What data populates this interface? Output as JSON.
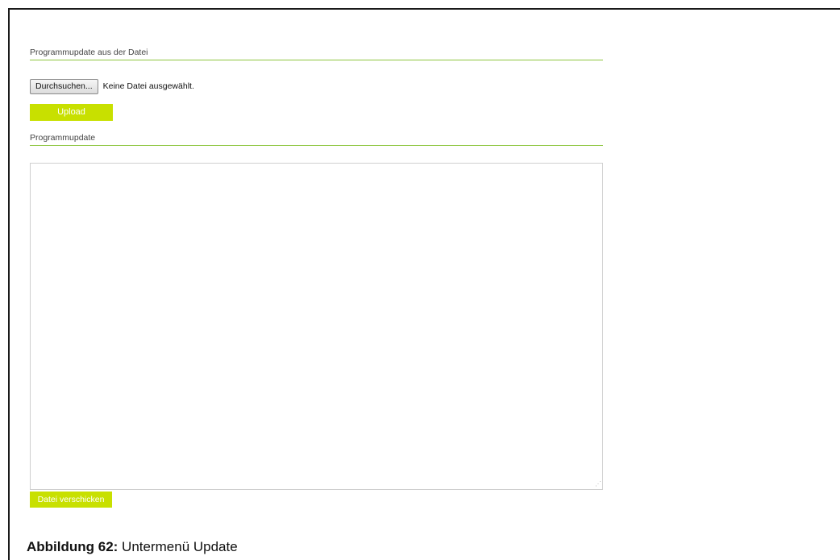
{
  "sections": {
    "file_update_title": "Programmupdate aus der Datei",
    "program_update_title": "Programmupdate"
  },
  "file_input": {
    "browse_label": "Durchsuchen...",
    "status_text": "Keine Datei ausgewählt."
  },
  "buttons": {
    "upload_label": "Upload",
    "send_label": "Datei verschicken"
  },
  "editor": {
    "value": ""
  },
  "caption": {
    "label": "Abbildung 62:",
    "text": " Untermenü Update"
  },
  "colors": {
    "accent": "#c8e000",
    "divider": "#8dc63f"
  }
}
